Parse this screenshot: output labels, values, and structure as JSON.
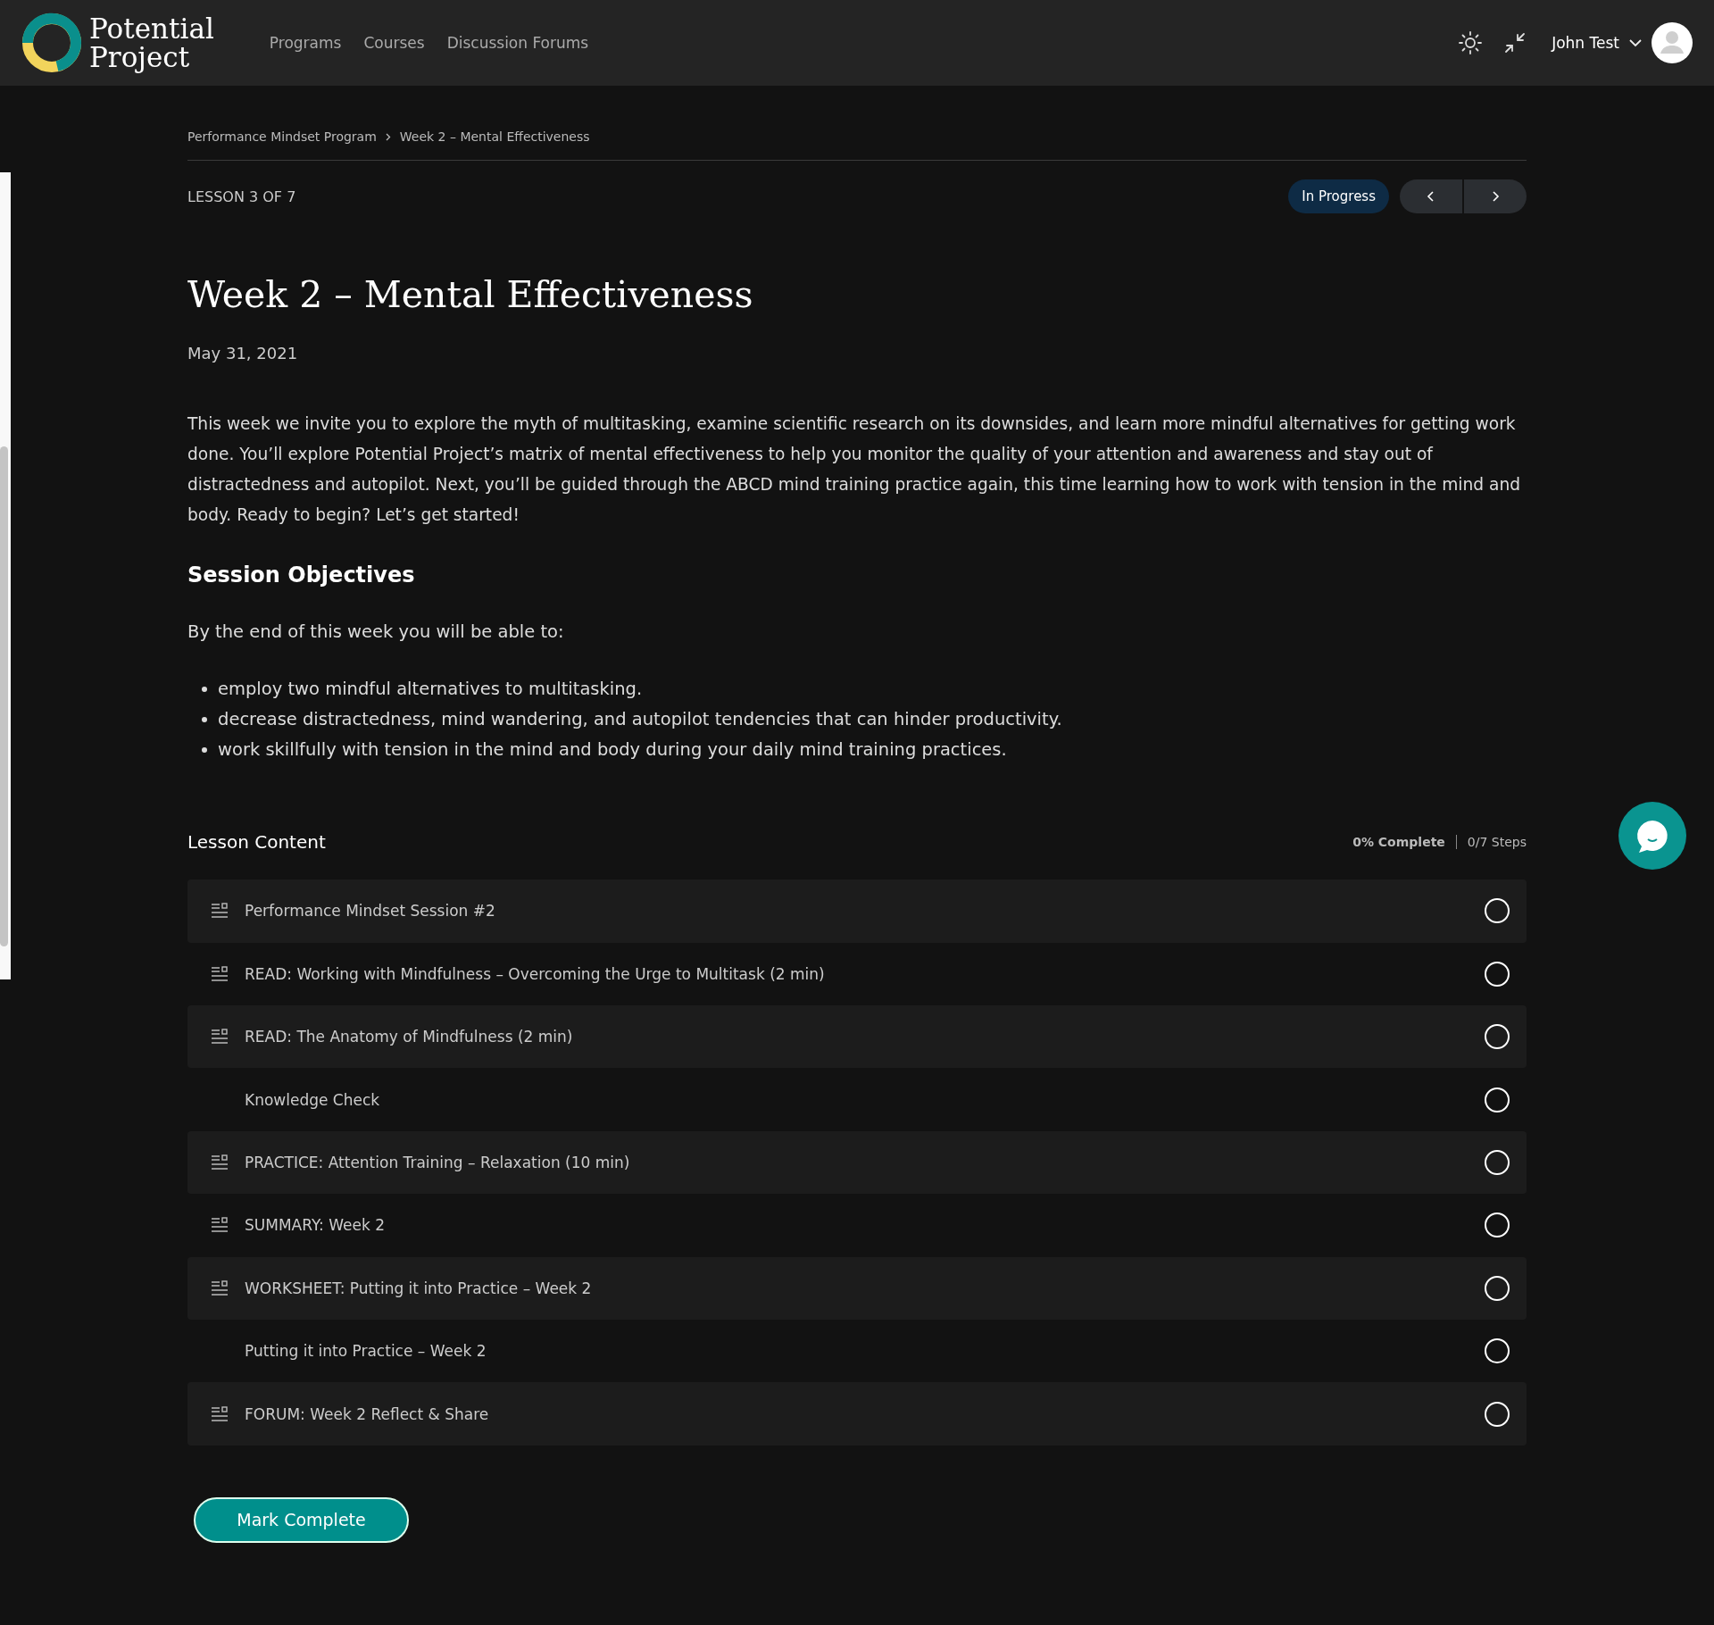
{
  "header": {
    "logo_text": [
      "Potential",
      "Project"
    ],
    "nav": [
      {
        "label": "Programs"
      },
      {
        "label": "Courses"
      },
      {
        "label": "Discussion Forums"
      }
    ],
    "user_name": "John Test"
  },
  "breadcrumb": [
    "Performance Mindset Program",
    "Week 2 – Mental Effectiveness"
  ],
  "lesson_counter": "LESSON 3 OF 7",
  "status_badge": "In Progress",
  "title": "Week 2 – Mental Effectiveness",
  "date": "May 31, 2021",
  "intro": "This week we invite you to explore the myth of multitasking, examine scientific research on its downsides, and learn more mindful alternatives for getting work done. You’ll explore Potential Project’s matrix of mental effectiveness to help you monitor the quality of your attention and awareness and stay out of distractedness and autopilot. Next, you’ll be guided through the ABCD mind training practice again, this time learning how to work with tension in the mind and body. Ready to begin? Let’s get started!",
  "objectives_heading": "Session Objectives",
  "objectives_lead": "By the end of this week you will be able to:",
  "objectives": [
    "employ two mindful alternatives to multitasking.",
    "decrease distractedness, mind wandering, and autopilot tendencies that can hinder productivity.",
    "work skillfully with tension in the mind and body during your daily mind training practices."
  ],
  "lesson_content": {
    "heading": "Lesson Content",
    "percent": "0% Complete",
    "steps": "0/7 Steps",
    "items": [
      {
        "title": "Performance Mindset Session #2",
        "kind": "topic",
        "completed": false
      },
      {
        "title": "READ: Working with Mindfulness – Overcoming the Urge to Multitask (2 min)",
        "kind": "topic",
        "completed": false
      },
      {
        "title": "READ: The Anatomy of Mindfulness (2 min)",
        "kind": "topic",
        "completed": false
      },
      {
        "title": "Knowledge Check",
        "kind": "quiz",
        "completed": false
      },
      {
        "title": "PRACTICE: Attention Training – Relaxation (10 min)",
        "kind": "topic",
        "completed": false
      },
      {
        "title": "SUMMARY: Week 2",
        "kind": "topic",
        "completed": false
      },
      {
        "title": "WORKSHEET: Putting it into Practice – Week 2",
        "kind": "topic",
        "completed": false
      },
      {
        "title": "Putting it into Practice – Week 2",
        "kind": "quiz",
        "completed": false
      },
      {
        "title": "FORUM: Week 2 Reflect & Share",
        "kind": "topic",
        "completed": false
      }
    ]
  },
  "mark_complete": "Mark Complete"
}
